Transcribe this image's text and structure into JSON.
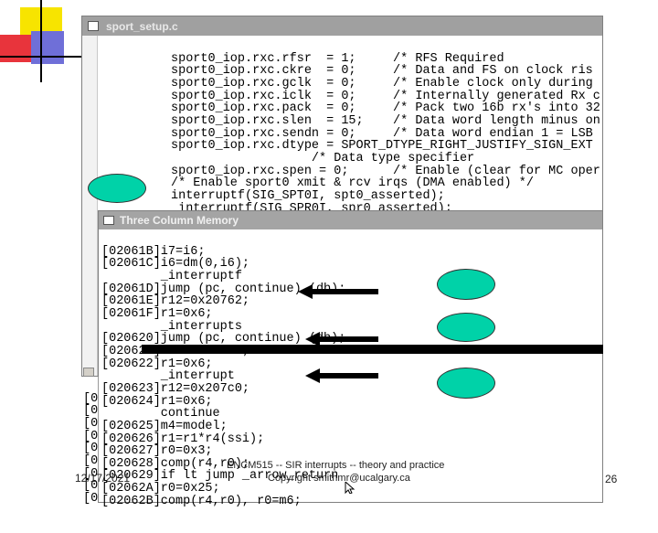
{
  "win_back": {
    "title": "sport_setup.c",
    "lines": [
      "sport0_iop.rxc.rfsr  = 1;     /* RFS Required",
      "sport0_iop.rxc.ckre  = 0;     /* Data and FS on clock ris",
      "sport0_iop.rxc.gclk  = 0;     /* Enable clock only during",
      "sport0_iop.rxc.iclk  = 0;     /* Internally generated Rx c",
      "sport0_iop.rxc.pack  = 0;     /* Pack two 16b rx's into 32",
      "sport0_iop.rxc.slen  = 15;    /* Data word length minus on",
      "sport0_iop.rxc.sendn = 0;     /* Data word endian 1 = LSB",
      "sport0_iop.rxc.dtype = SPORT_DTYPE_RIGHT_JUSTIFY_SIGN_EXT",
      "                   /* Data type specifier",
      "sport0_iop.rxc.spen = 0;      /* Enable (clear for MC oper",
      "/* Enable sport0 xmit & rcv irqs (DMA enabled) */",
      "interruptf(SIG_SPT0I, spt0_asserted);",
      " interruptf(SIG_SPR0I, spr0_asserted);"
    ]
  },
  "win_front": {
    "title": "Three Column Memory",
    "lines": [
      "[02061B]i7=i6;",
      "[02061C]i6=dm(0,i6);",
      "        _interruptf",
      "[02061D]jump (pc, continue) (db);",
      "[02061E]r12=0x20762;",
      "[02061F]r1=0x6;",
      "        _interrupts",
      "[020620]jump (pc, continue) (db);",
      "[020621]r12=0x207a0;",
      "[020622]r1=0x6;",
      "        _interrupt",
      "[020623]r12=0x207c0;",
      "[020624]r1=0x6;",
      "        continue",
      "[020625]m4=model;",
      "[020626]r1=r1*r4(ssi);",
      "[020627]r0=0x3;",
      "[020628]comp(r4,r0);",
      "[020629]if lt jump _arrow_return",
      "[02062A]r0=0x25;",
      "[02062B]comp(r4,r0), r0=m6;"
    ]
  },
  "left_strip": [
    "[0",
    "[0",
    "[0",
    "[0",
    "[0",
    "[0",
    "[0",
    "[0",
    "[0"
  ],
  "footer": {
    "date": "12/17/2021",
    "course": "ENCM515 -- SIR interrupts -- theory and practice",
    "copyright": "Copyright smithmr@ucalgary.ca",
    "page": "26"
  },
  "colors": {
    "ellipse": "#00d2a8",
    "highlight": "#000000"
  }
}
